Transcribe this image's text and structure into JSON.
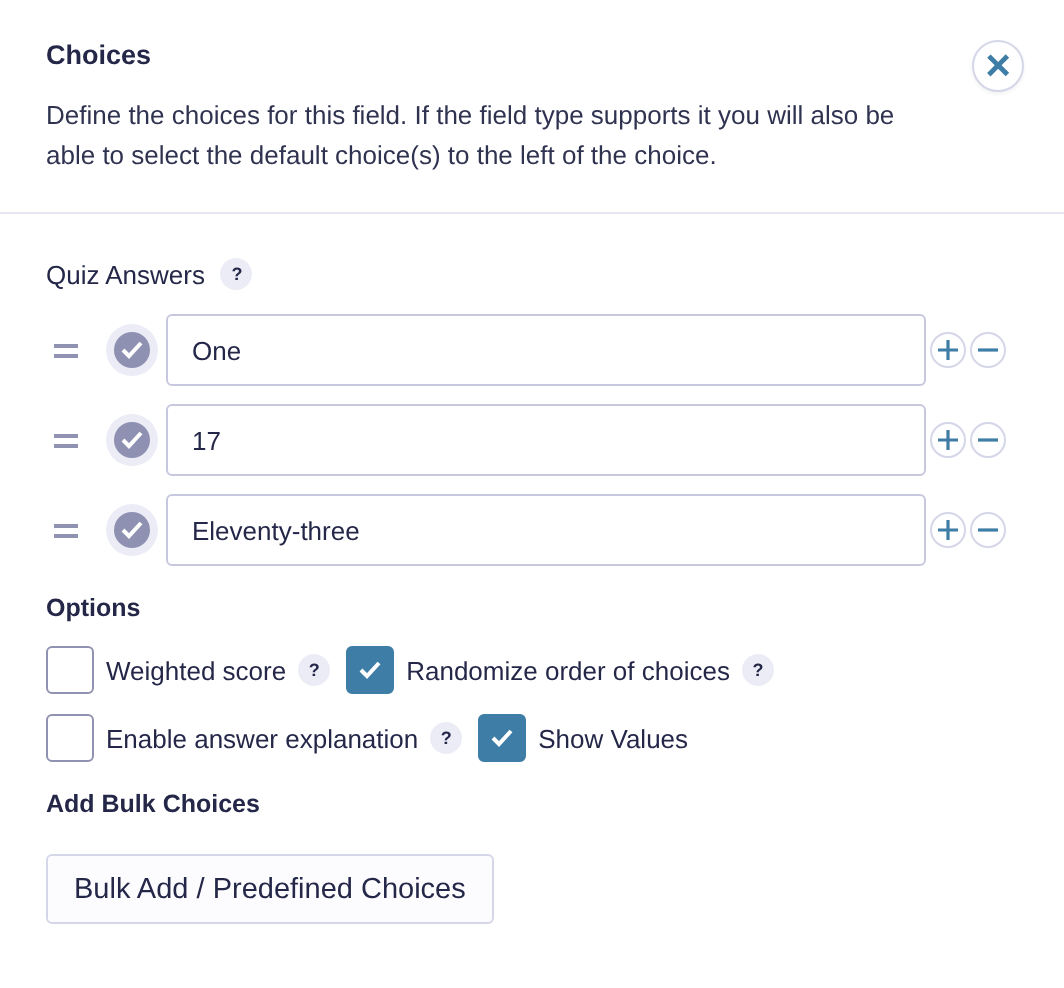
{
  "header": {
    "title": "Choices",
    "description": "Define the choices for this field. If the field type supports it you will also be able to select the default choice(s) to the left of the choice.",
    "close": "×"
  },
  "choices": {
    "label": "Quiz Answers",
    "help": "?",
    "items": [
      {
        "value": "One",
        "selected": false
      },
      {
        "value": "17",
        "selected": false
      },
      {
        "value": "Eleventy-three",
        "selected": false
      }
    ]
  },
  "options": {
    "title": "Options",
    "rows": [
      [
        {
          "label": "Weighted score",
          "checked": false,
          "help": "?"
        },
        {
          "label": "Randomize order of choices",
          "checked": true,
          "help": "?"
        }
      ],
      [
        {
          "label": "Enable answer explanation",
          "checked": false,
          "help": "?"
        },
        {
          "label": "Show Values",
          "checked": true
        }
      ]
    ]
  },
  "bulk": {
    "title": "Add Bulk Choices",
    "button": "Bulk Add / Predefined Choices"
  }
}
